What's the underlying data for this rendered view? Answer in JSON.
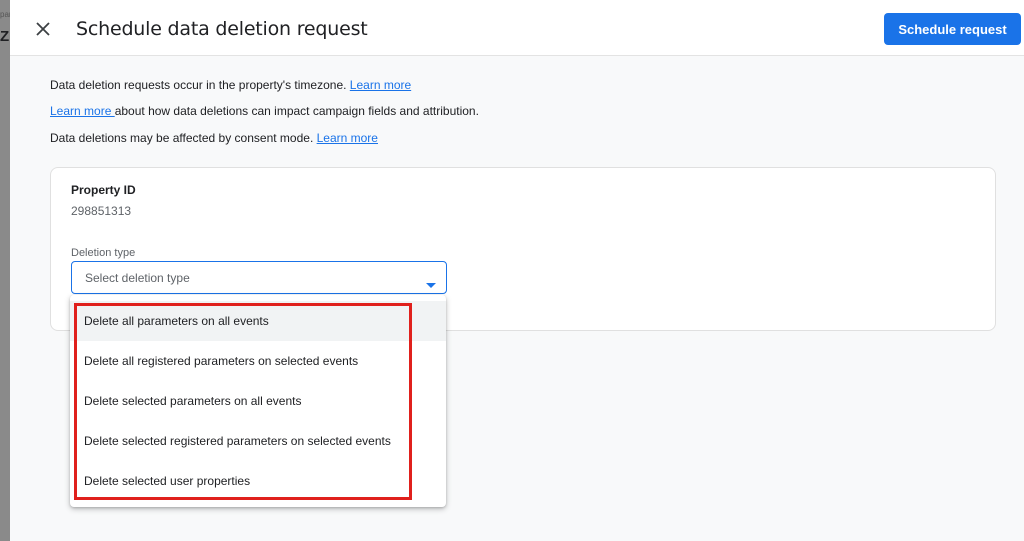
{
  "background_window": {
    "peek_top": "par",
    "peek_big": "Z"
  },
  "header": {
    "title": "Schedule data deletion request",
    "primary_button": "Schedule request",
    "close_icon": "close-icon"
  },
  "info": {
    "line1_text": "Data deletion requests occur in the property's timezone. ",
    "line1_link": "Learn more",
    "line2_link": "Learn more ",
    "line2_text": "about how data deletions can impact campaign fields and attribution.",
    "line3_text": "Data deletions may be affected by consent mode. ",
    "line3_link": "Learn more"
  },
  "property": {
    "label": "Property ID",
    "value": "298851313"
  },
  "deletion_type": {
    "label": "Deletion type",
    "placeholder": "Select deletion type",
    "options": [
      "Delete all parameters on all events",
      "Delete all registered parameters on selected events",
      "Delete selected parameters on all events",
      "Delete selected registered parameters on selected events",
      "Delete selected user properties"
    ]
  },
  "colors": {
    "accent": "#1a73e8",
    "highlight": "#e0201c"
  }
}
